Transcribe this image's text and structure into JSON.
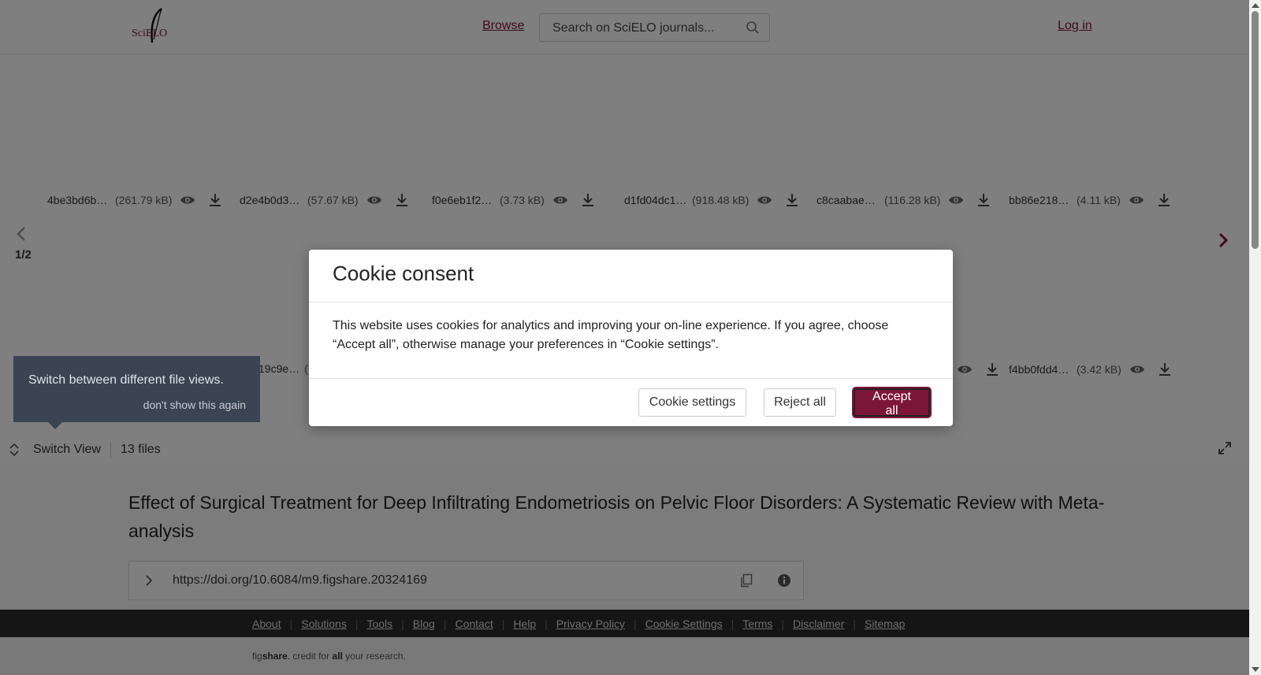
{
  "header": {
    "logo_alt": "SciELO",
    "browse": "Browse",
    "search_placeholder": "Search on SciELO journals...",
    "login": "Log in"
  },
  "viewer": {
    "row1": [
      {
        "name": "4be3bd6b…",
        "size": "(261.79 kB)"
      },
      {
        "name": "d2e4b0d3b…",
        "size": "(57.67 kB)"
      },
      {
        "name": "f0e6eb1f2aa…",
        "size": "(3.73 kB)"
      },
      {
        "name": "d1fd04dc1…",
        "size": "(918.48 kB)"
      },
      {
        "name": "c8caabae…",
        "size": "(116.28 kB)"
      },
      {
        "name": "bb86e21853…",
        "size": "(4.11 kB)"
      }
    ],
    "row2_partial": {
      "name": "19c9e…",
      "size": "("
    },
    "row2_last": {
      "name": "f4bb0fdd4e7…",
      "size": "(3.42 kB)"
    },
    "page_indicator": "1/2",
    "tooltip_text": "Switch between different file views.",
    "tooltip_dismiss": "don't show this again",
    "switch_view": "Switch View",
    "files_count": "13 files"
  },
  "article": {
    "title": "Effect of Surgical Treatment for Deep Infiltrating Endometriosis on Pelvic Floor Disorders: A Systematic Review with Meta-analysis",
    "doi": "https://doi.org/10.6084/m9.figshare.20324169"
  },
  "footer": {
    "links": [
      "About",
      "Solutions",
      "Tools",
      "Blog",
      "Contact",
      "Help",
      "Privacy Policy",
      "Cookie Settings",
      "Terms",
      "Disclaimer",
      "Sitemap"
    ],
    "tag_fig": "fig",
    "tag_share": "share",
    "tag_mid": ". credit for ",
    "tag_all": "all",
    "tag_end": " your research."
  },
  "cookie_modal": {
    "title": "Cookie consent",
    "body": "This website uses cookies for analytics and improving your on-line experience. If you agree, choose “Accept all”, otherwise manage your preferences in “Cookie settings”.",
    "settings_button": "Cookie settings",
    "reject_button": "Reject all",
    "accept_button": "Accept all"
  },
  "colors": {
    "brand": "#7c1638",
    "footer_bg": "#2a2a2a",
    "overlay": "rgba(0,0,0,0.5)"
  },
  "icons": [
    "search-icon",
    "eye-icon",
    "download-icon",
    "chevron-left-icon",
    "chevron-right-icon",
    "switch-view-icon",
    "fullscreen-icon",
    "chevron-right-icon",
    "copy-icon",
    "info-icon"
  ]
}
